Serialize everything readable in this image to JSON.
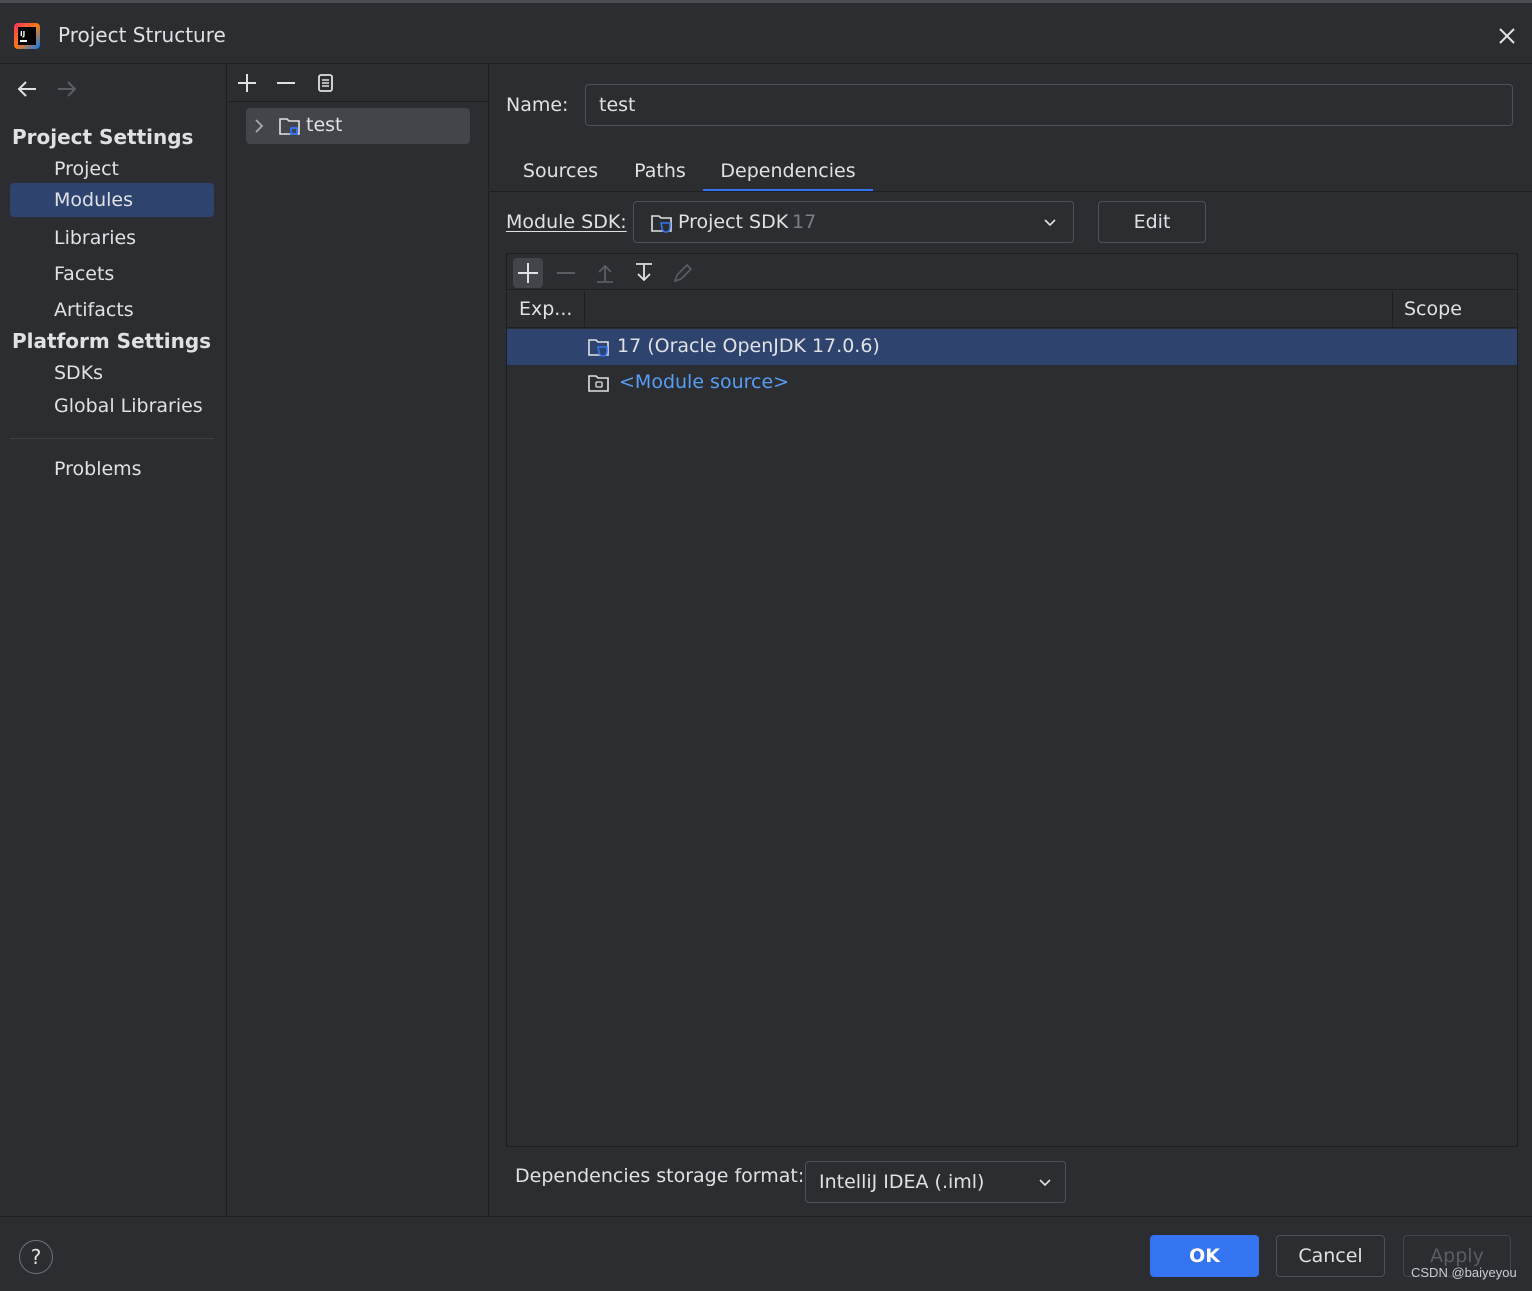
{
  "window": {
    "title": "Project Structure"
  },
  "nav": {
    "project_settings_heading": "Project Settings",
    "project_settings_items": [
      {
        "label": "Project",
        "selected": false
      },
      {
        "label": "Modules",
        "selected": true
      },
      {
        "label": "Libraries",
        "selected": false
      },
      {
        "label": "Facets",
        "selected": false
      },
      {
        "label": "Artifacts",
        "selected": false
      }
    ],
    "platform_settings_heading": "Platform Settings",
    "platform_settings_items": [
      {
        "label": "SDKs"
      },
      {
        "label": "Global Libraries"
      }
    ],
    "problems_label": "Problems"
  },
  "modules_tree": {
    "items": [
      {
        "label": "test"
      }
    ]
  },
  "module": {
    "name_label": "Name:",
    "name_value": "test",
    "tabs": [
      {
        "label": "Sources",
        "active": false
      },
      {
        "label": "Paths",
        "active": false
      },
      {
        "label": "Dependencies",
        "active": true
      }
    ],
    "sdk_label": "Module SDK:",
    "sdk_value": "Project SDK",
    "sdk_version": "17",
    "edit_label": "Edit"
  },
  "dependencies": {
    "columns": [
      "Exp...",
      "",
      "Scope"
    ],
    "rows": [
      {
        "label": "17 (Oracle OpenJDK 17.0.6)",
        "icon": "jdk-folder-icon",
        "selected": true
      },
      {
        "label": "<Module source>",
        "icon": "source-folder-icon",
        "selected": false
      }
    ],
    "storage_label": "Dependencies storage format:",
    "storage_value": "IntelliJ IDEA (.iml)"
  },
  "footer": {
    "help_label": "?",
    "ok_label": "OK",
    "cancel_label": "Cancel",
    "apply_label": "Apply",
    "watermark": "CSDN @baiyeyou"
  },
  "colors": {
    "background": "#2b2d30",
    "selection": "#2e436e",
    "accent": "#3574f0",
    "link": "#589df6",
    "text": "#dfe1e5"
  }
}
